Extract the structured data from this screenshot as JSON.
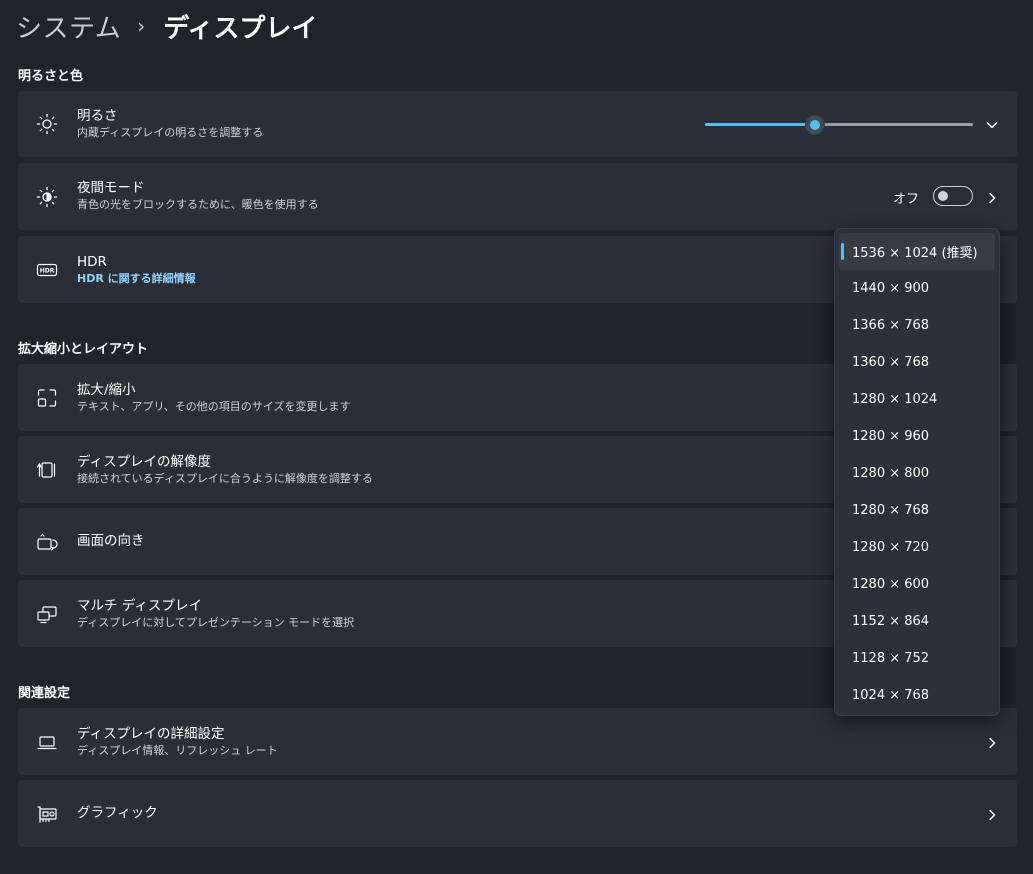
{
  "breadcrumb": {
    "parent": "システム",
    "separator": "›",
    "current": "ディスプレイ"
  },
  "sections": {
    "brightness_color": "明るさと色",
    "scale_layout": "拡大縮小とレイアウト",
    "related": "関連設定"
  },
  "brightness": {
    "title": "明るさ",
    "subtitle": "内蔵ディスプレイの明るさを調整する",
    "level": 0.41
  },
  "night_mode": {
    "title": "夜間モード",
    "subtitle": "青色の光をブロックするために、暖色を使用する",
    "state_label": "オフ"
  },
  "hdr": {
    "title": "HDR",
    "link": "HDR に関する詳細情報"
  },
  "scale": {
    "title": "拡大/縮小",
    "subtitle": "テキスト、アプリ、その他の項目のサイズを変更します"
  },
  "resolution": {
    "title": "ディスプレイの解像度",
    "subtitle": "接続されているディスプレイに合うように解像度を調整する"
  },
  "orientation": {
    "title": "画面の向き"
  },
  "multi_display": {
    "title": "マルチ ディスプレイ",
    "subtitle": "ディスプレイに対してプレゼンテーション モードを選択"
  },
  "advanced_display": {
    "title": "ディスプレイの詳細設定",
    "subtitle": "ディスプレイ情報、リフレッシュ レート"
  },
  "graphics": {
    "title": "グラフィック"
  },
  "resolution_options": [
    "1536 × 1024 (推奨)",
    "1440 × 900",
    "1366 × 768",
    "1360 × 768",
    "1280 × 1024",
    "1280 × 960",
    "1280 × 800",
    "1280 × 768",
    "1280 × 720",
    "1280 × 600",
    "1152 × 864",
    "1128 × 752",
    "1024 × 768"
  ],
  "selected_resolution": "1536 × 1024 (推奨)",
  "colors": {
    "background": "#1f232a",
    "card": "#2a2f37",
    "accent": "#4cc2ff",
    "link": "#8dd3ff"
  }
}
